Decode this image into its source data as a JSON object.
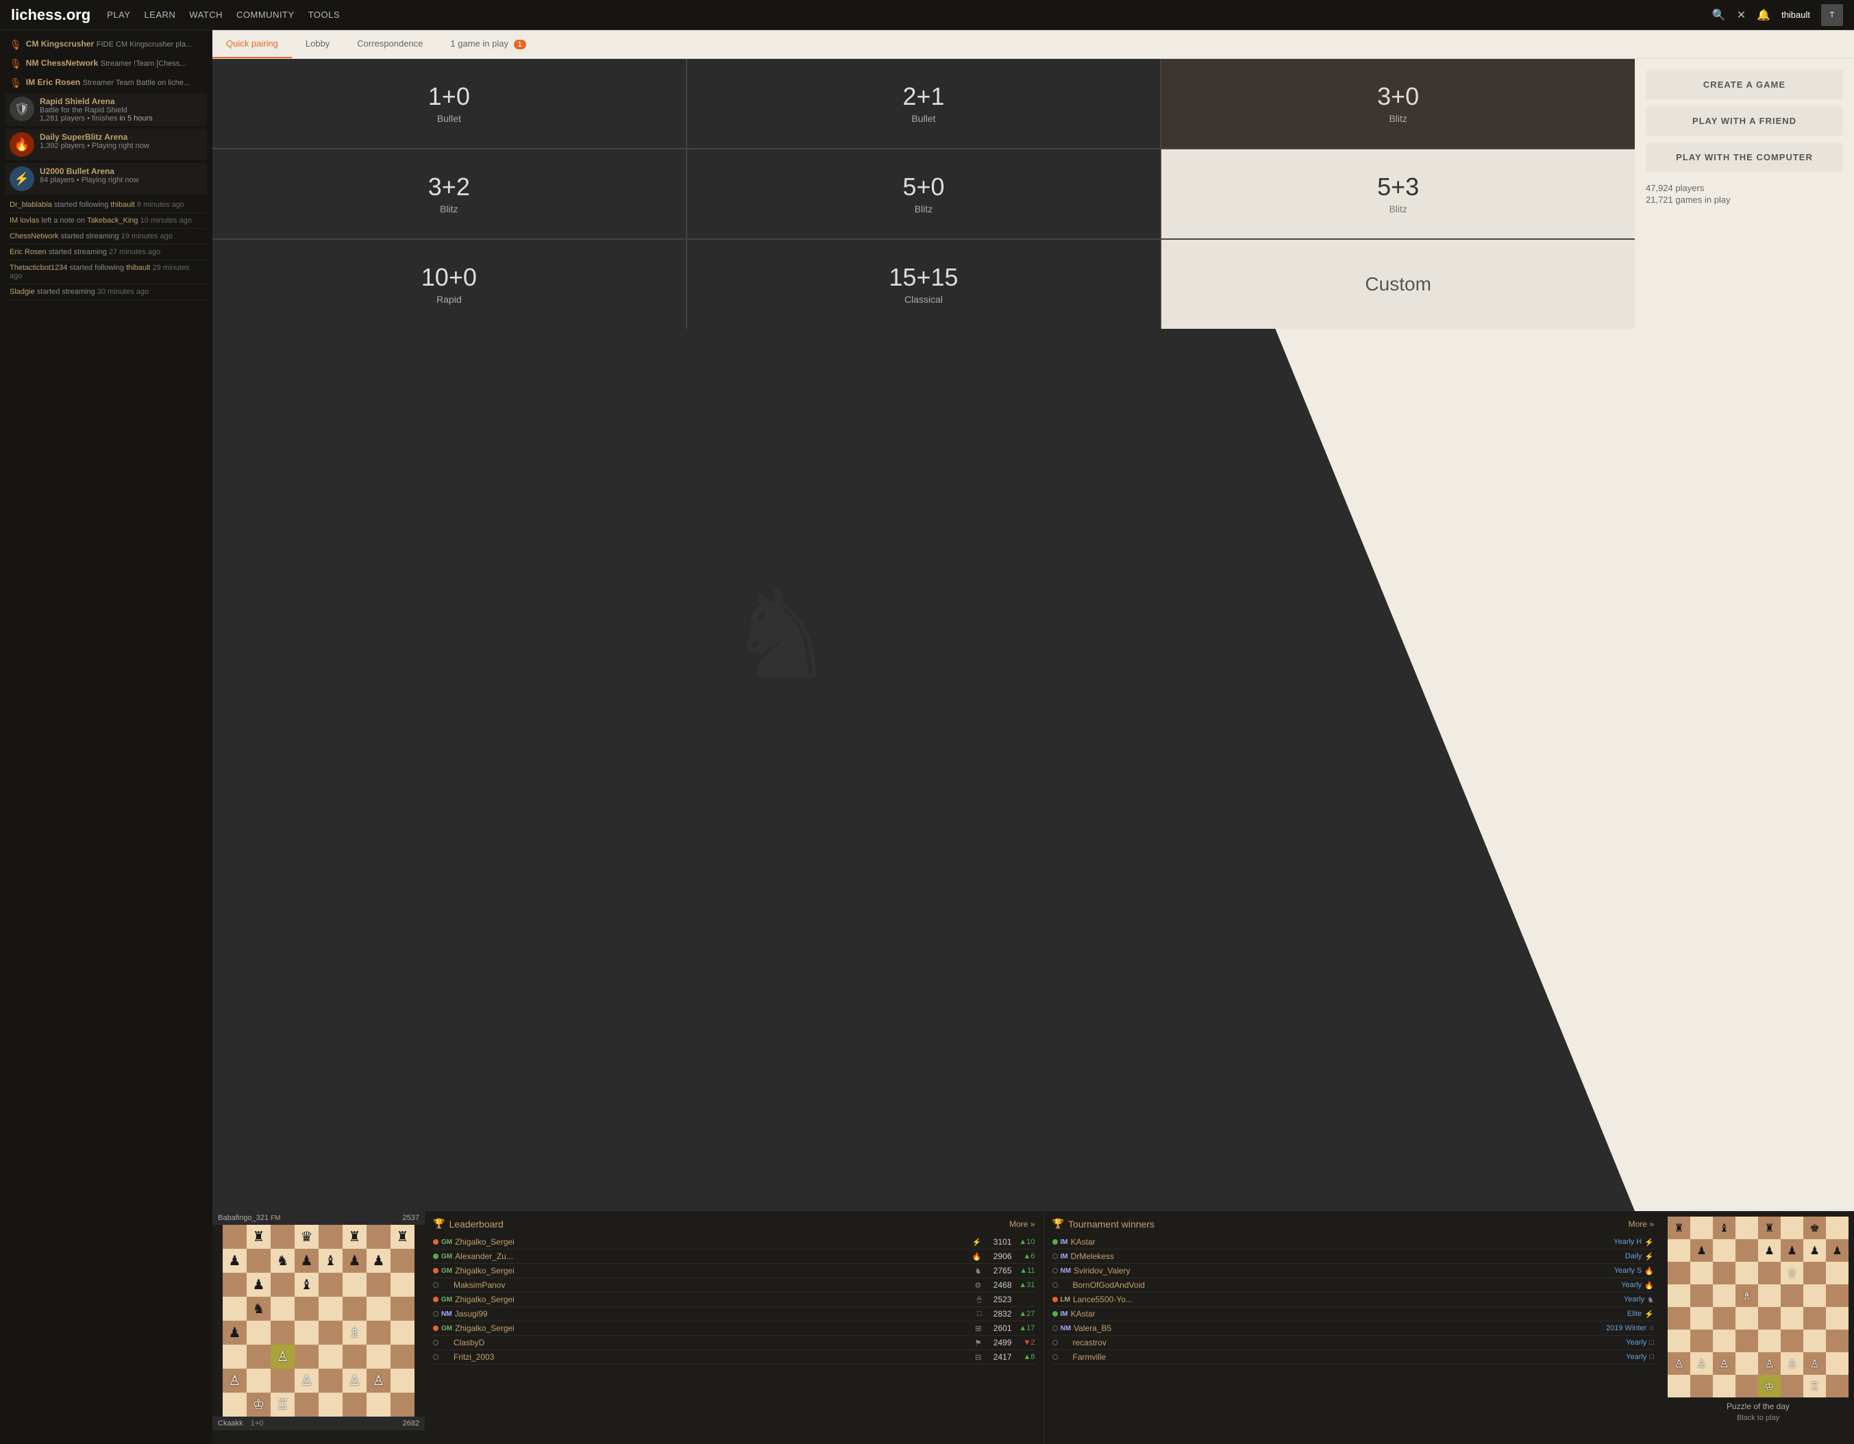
{
  "nav": {
    "logo": "lichess.org",
    "links": [
      "PLAY",
      "LEARN",
      "WATCH",
      "COMMUNITY",
      "TOOLS"
    ],
    "username": "thibault",
    "icons": [
      "search",
      "close",
      "bell"
    ]
  },
  "tabs": {
    "items": [
      {
        "label": "Quick pairing",
        "active": true,
        "badge": null
      },
      {
        "label": "Lobby",
        "active": false,
        "badge": null
      },
      {
        "label": "Correspondence",
        "active": false,
        "badge": null
      },
      {
        "label": "1 game in play",
        "active": false,
        "badge": "1"
      }
    ]
  },
  "pairing": {
    "cells": [
      {
        "time": "1+0",
        "type": "Bullet",
        "theme": "dark"
      },
      {
        "time": "2+1",
        "type": "Bullet",
        "theme": "dark"
      },
      {
        "time": "3+0",
        "type": "Blitz",
        "theme": "mixed"
      },
      {
        "time": "3+2",
        "type": "Blitz",
        "theme": "dark"
      },
      {
        "time": "5+0",
        "type": "Blitz",
        "theme": "dark"
      },
      {
        "time": "5+3",
        "type": "Blitz",
        "theme": "light"
      },
      {
        "time": "10+0",
        "type": "Rapid",
        "theme": "dark"
      },
      {
        "time": "15+15",
        "type": "Classical",
        "theme": "dark"
      },
      {
        "time": "Custom",
        "type": "",
        "theme": "light"
      }
    ]
  },
  "rightPanel": {
    "buttons": [
      "CREATE A GAME",
      "PLAY WITH A FRIEND",
      "PLAY WITH THE COMPUTER"
    ],
    "stats": {
      "players": "47,924 players",
      "games": "21,721 games in play"
    }
  },
  "sidebar": {
    "streamers": [
      {
        "icon": "🎙",
        "name": "CM Kingscrusher",
        "desc": "FIDE CM Kingscrusher pla..."
      },
      {
        "icon": "🎙",
        "name": "NM ChessNetwork",
        "desc": "Streamer !Team [Chess..."
      },
      {
        "icon": "🎙",
        "name": "IM Eric Rosen",
        "desc": "Streamer Team Battle on liche..."
      }
    ],
    "events": [
      {
        "icon": "🛡",
        "iconBg": "shield",
        "title": "Rapid Shield Arena",
        "sub1": "Battle for the Rapid Shield",
        "sub2": "1,281 players • finishes in 5 hours"
      },
      {
        "icon": "🔥",
        "iconBg": "fire",
        "title": "Daily SuperBlitz Arena",
        "sub1": "1,392 players • Playing right now"
      },
      {
        "icon": "⚡",
        "iconBg": "bolt",
        "title": "U2000 Bullet Arena",
        "sub1": "84 players • Playing right now"
      }
    ],
    "activity": [
      {
        "text": "Dr_blablabla started following thibault",
        "time": "8 minutes ago"
      },
      {
        "text": "IM lovlas left a note on Takeback_King",
        "time": "10 minutes ago"
      },
      {
        "text": "ChessNetwork started streaming",
        "time": "19 minutes ago"
      },
      {
        "text": "Eric Rosen started streaming",
        "time": "27 minutes ago"
      },
      {
        "text": "Thetacticbot1234 started following thibault",
        "time": "29 minutes ago"
      },
      {
        "text": "Sladgie started streaming",
        "time": "30 minutes ago"
      }
    ]
  },
  "leaderboard": {
    "title": "Leaderboard",
    "more": "More »",
    "rows": [
      {
        "status": "streamer",
        "title": "GM",
        "name": "Zhigalko_Sergei",
        "icon": "⚡",
        "rating": "3101",
        "trend": "▲10"
      },
      {
        "status": "online",
        "title": "GM",
        "name": "Alexander_Zu...",
        "icon": "🔥",
        "rating": "2906",
        "trend": "▲6"
      },
      {
        "status": "streamer",
        "title": "GM",
        "name": "Zhigalko_Sergei",
        "icon": "♞",
        "rating": "2765",
        "trend": "▲11"
      },
      {
        "status": "offline",
        "title": "",
        "name": "MaksimPanov",
        "icon": "⚙",
        "rating": "2468",
        "trend": "▲31"
      },
      {
        "status": "streamer",
        "title": "GM",
        "name": "Zhigalko_Sergei",
        "icon": "🖱",
        "rating": "2523",
        "trend": ""
      },
      {
        "status": "offline",
        "title": "NM",
        "name": "Jasugi99",
        "icon": "□",
        "rating": "2832",
        "trend": "▲27"
      },
      {
        "status": "streamer",
        "title": "GM",
        "name": "Zhigalko_Sergei",
        "icon": "⊞",
        "rating": "2601",
        "trend": "▲17"
      },
      {
        "status": "offline",
        "title": "",
        "name": "ClasbyD",
        "icon": "⚑",
        "rating": "2499",
        "trend": "▼2"
      },
      {
        "status": "offline",
        "title": "",
        "name": "Fritzi_2003",
        "icon": "⊟",
        "rating": "2417",
        "trend": "▲8"
      }
    ]
  },
  "tournament": {
    "title": "Tournament winners",
    "more": "More »",
    "rows": [
      {
        "status": "online",
        "title": "IM",
        "name": "KAstar",
        "tournament": "Yearly H",
        "icon": "⚡"
      },
      {
        "status": "offline",
        "title": "IM",
        "name": "DrMelekess",
        "tournament": "Daily",
        "icon": "⚡"
      },
      {
        "status": "offline",
        "title": "NM",
        "name": "Sviridov_Valery",
        "tournament": "Yearly S",
        "icon": "🔥"
      },
      {
        "status": "offline",
        "title": "",
        "name": "BornOfGodAndVoid",
        "tournament": "Yearly",
        "icon": "🔥"
      },
      {
        "status": "streamer",
        "title": "LM",
        "name": "Lance5500-Yo...",
        "tournament": "Yearly",
        "icon": "♞"
      },
      {
        "status": "online",
        "title": "IM",
        "name": "KAstar",
        "tournament": "Elite",
        "icon": "⚡"
      },
      {
        "status": "offline",
        "title": "NM",
        "name": "Valera_B5",
        "tournament": "2019 Winter",
        "icon": "○"
      },
      {
        "status": "offline",
        "title": "",
        "name": "recastrov",
        "tournament": "Yearly",
        "icon": "□"
      },
      {
        "status": "offline",
        "title": "",
        "name": "Farmville",
        "tournament": "Yearly",
        "icon": "□"
      }
    ]
  },
  "miniboard_left": {
    "player1": "Ckaakk",
    "rating1": "2682",
    "player2": "Babafingo_321",
    "rating2": "2537",
    "fm": "FM",
    "timecontrol": "1+0"
  },
  "miniboard_right": {
    "label1": "Puzzle of the day",
    "label2": "Black to play"
  }
}
